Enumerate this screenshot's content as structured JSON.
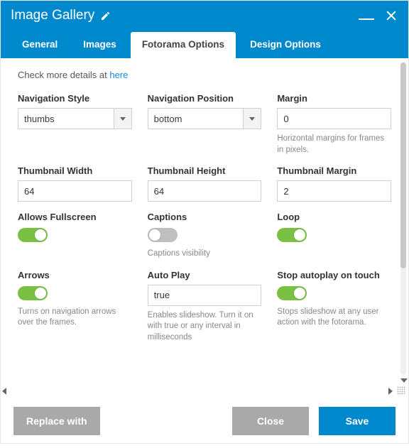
{
  "header": {
    "title": "Image Gallery"
  },
  "tabs": [
    {
      "label": "General"
    },
    {
      "label": "Images"
    },
    {
      "label": "Fotorama Options"
    },
    {
      "label": "Design Options"
    }
  ],
  "hint": {
    "prefix": "Check more details at ",
    "link": "here"
  },
  "fields": {
    "navStyle": {
      "label": "Navigation Style",
      "value": "thumbs"
    },
    "navPosition": {
      "label": "Navigation Position",
      "value": "bottom"
    },
    "margin": {
      "label": "Margin",
      "value": "0",
      "help": "Horizontal margins for frames in pixels."
    },
    "thumbWidth": {
      "label": "Thumbnail Width",
      "value": "64"
    },
    "thumbHeight": {
      "label": "Thumbnail Height",
      "value": "64"
    },
    "thumbMargin": {
      "label": "Thumbnail Margin",
      "value": "2"
    },
    "fullscreen": {
      "label": "Allows Fullscreen"
    },
    "captions": {
      "label": "Captions",
      "help": "Captions visibility"
    },
    "loop": {
      "label": "Loop"
    },
    "arrows": {
      "label": "Arrows",
      "help": "Turns on navigation arrows over the frames."
    },
    "autoplay": {
      "label": "Auto Play",
      "value": "true",
      "help": "Enables slideshow. Turn it on with true or any interval in milliseconds"
    },
    "stopAutoplay": {
      "label": "Stop autoplay on touch",
      "help": "Stops slideshow at any user action with the fotorama."
    }
  },
  "buttons": {
    "replace": "Replace with",
    "close": "Close",
    "save": "Save"
  }
}
